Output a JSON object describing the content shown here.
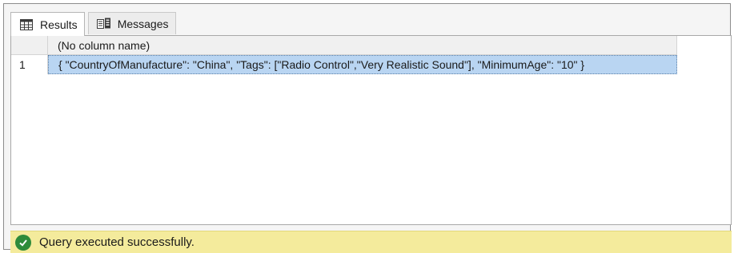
{
  "tabs": [
    {
      "label": "Results",
      "icon": "grid-icon",
      "active": true
    },
    {
      "label": "Messages",
      "icon": "messages-icon",
      "active": false
    }
  ],
  "grid": {
    "columns": [
      "(No column name)"
    ],
    "rows": [
      {
        "number": "1",
        "values": [
          "{ \"CountryOfManufacture\": \"China\", \"Tags\": [\"Radio Control\",\"Very Realistic Sound\"], \"MinimumAge\": \"10\" }"
        ]
      }
    ]
  },
  "status": {
    "text": "Query executed successfully.",
    "icon": "check-circle-icon",
    "color": "#f4eb9c"
  },
  "colors": {
    "selected_cell": "#b9d5f2",
    "status_ok": "#2e8b3a"
  }
}
